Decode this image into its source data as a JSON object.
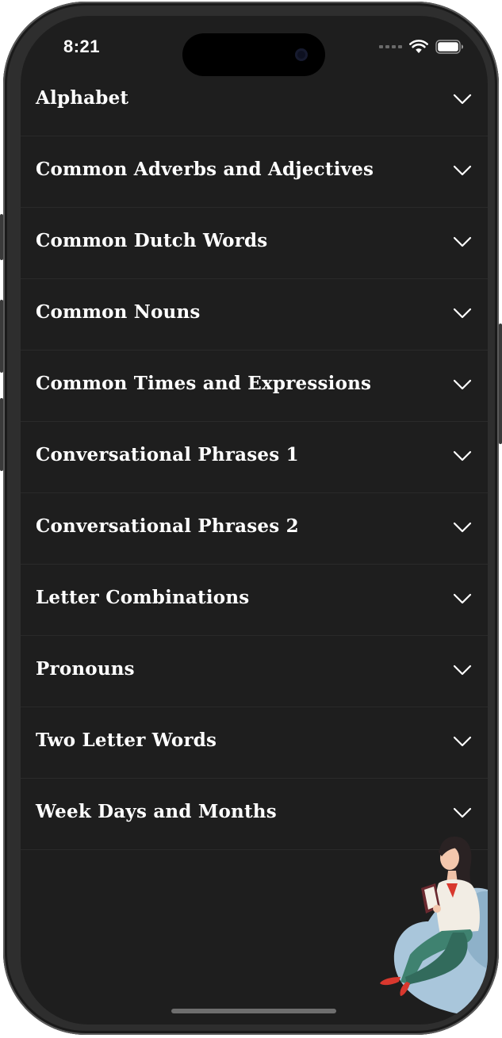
{
  "status_bar": {
    "time": "8:21"
  },
  "topics": [
    {
      "label": "Alphabet"
    },
    {
      "label": "Common Adverbs and Adjectives"
    },
    {
      "label": "Common Dutch Words"
    },
    {
      "label": "Common Nouns"
    },
    {
      "label": "Common Times and Expressions"
    },
    {
      "label": "Conversational Phrases 1"
    },
    {
      "label": "Conversational Phrases 2"
    },
    {
      "label": "Letter Combinations"
    },
    {
      "label": "Pronouns"
    },
    {
      "label": "Two Letter Words"
    },
    {
      "label": "Week Days and Months"
    }
  ],
  "icons": {
    "expand": "chevron-down-icon",
    "wifi": "wifi-icon",
    "battery": "battery-icon"
  },
  "colors": {
    "background": "#1e1e1e",
    "text": "#ffffff",
    "chair": "#a9c6db",
    "shirt": "#f2ede4",
    "pants": "#3f8270",
    "shoes": "#d8382e"
  }
}
